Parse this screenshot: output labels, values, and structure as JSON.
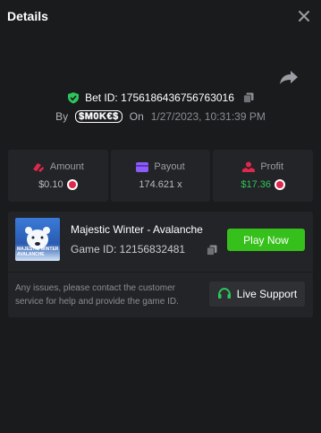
{
  "header": {
    "title": "Details"
  },
  "bet": {
    "id_text": "Bet ID: 1756186436756763016",
    "by_label": "By",
    "user": "$M0K€$",
    "on_label": "On",
    "date": "1/27/2023, 10:31:39 PM"
  },
  "stats": [
    {
      "label": "Amount",
      "value": "$0.10",
      "icon": "coins-icon",
      "color": "#e2274d"
    },
    {
      "label": "Payout",
      "value": "174.621 x",
      "icon": "card-icon",
      "color": "#8b5cf6"
    },
    {
      "label": "Profit",
      "value": "$17.36",
      "icon": "profit-icon",
      "color": "#e2274d"
    }
  ],
  "game": {
    "name": "Majestic Winter - Avalanche",
    "id_text": "Game ID: 12156832481",
    "play_label": "Play Now",
    "thumb_text": "MAJESTIC WINTER AVALANCHE"
  },
  "support": {
    "message": "Any issues, please contact the customer service for help and provide the game ID.",
    "button_label": "Live Support"
  },
  "colors": {
    "accent_green": "#36c01c",
    "profit_green": "#2ec45b",
    "bg": "#1a1b1d",
    "card": "#232427"
  }
}
